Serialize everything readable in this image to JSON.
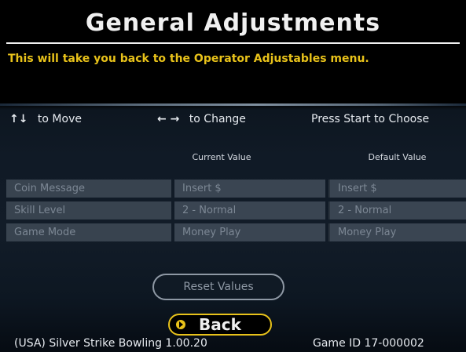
{
  "screen": {
    "title": "General Adjustments",
    "help_text": "This will take you back to the Operator Adjustables menu."
  },
  "controls": {
    "move": {
      "glyph": "↑↓",
      "label": "to Move"
    },
    "change": {
      "glyph": "← →",
      "label": "to Change"
    },
    "choose": {
      "label": "Press Start to Choose"
    }
  },
  "table": {
    "headers": {
      "current": "Current Value",
      "default": "Default Value"
    },
    "rows": [
      {
        "label": "Coin Message",
        "current": "Insert $",
        "default": "Insert $"
      },
      {
        "label": "Skill Level",
        "current": "2 - Normal",
        "default": "2 - Normal"
      },
      {
        "label": "Game Mode",
        "current": "Money Play",
        "default": "Money Play"
      }
    ]
  },
  "buttons": {
    "reset": "Reset Values",
    "back": "Back"
  },
  "footer": {
    "version": "(USA) Silver Strike Bowling 1.00.20",
    "game_id": "Game ID 17-000002"
  },
  "colors": {
    "accent_yellow": "#e8c21a",
    "text_white": "#f0f0f0",
    "disabled_gray": "#7c8794",
    "row_background": "#3a4552"
  }
}
